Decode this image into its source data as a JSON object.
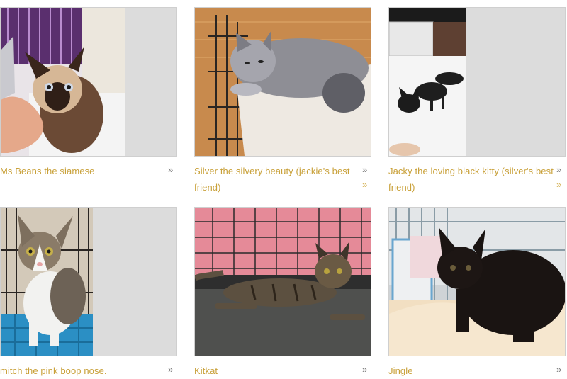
{
  "gallery": {
    "items": [
      {
        "caption": "Ms Beans the siamese",
        "icon": "chevron-double-right-icon"
      },
      {
        "caption": "Silver the silvery beauty (jackie's best friend)",
        "icon": "chevron-double-right-icon"
      },
      {
        "caption": "Jacky the loving black kitty (silver's best friend)",
        "icon": "chevron-double-right-icon"
      },
      {
        "caption": "mitch the pink boop nose.",
        "icon": "chevron-double-right-icon"
      },
      {
        "caption": "Kitkat",
        "icon": "chevron-double-right-icon"
      },
      {
        "caption": "Jingle",
        "icon": "chevron-double-right-icon"
      }
    ],
    "chevron_glyph": "»"
  },
  "colors": {
    "caption": "#c9a13a",
    "chevron": "#7a7a7a",
    "photo_border": "#cfcfcf",
    "photo_padding": "#dedede"
  }
}
